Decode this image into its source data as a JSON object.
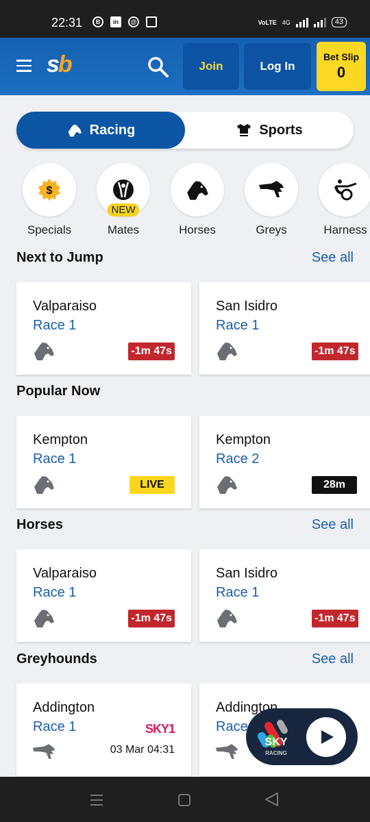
{
  "status_bar": {
    "time": "22:31",
    "notification_icons": [
      "b-icon",
      "linkedin-icon",
      "threads-icon",
      "browser-icon"
    ],
    "network": "4G",
    "battery": "43"
  },
  "header": {
    "logo_s": "s",
    "logo_b": "b",
    "join_label": "Join",
    "login_label": "Log In",
    "betslip_label": "Bet Slip",
    "betslip_count": "0"
  },
  "toggle": {
    "racing_label": "Racing",
    "sports_label": "Sports",
    "active": "Racing"
  },
  "categories": [
    {
      "label": "Specials",
      "icon": "dollar-badge-icon"
    },
    {
      "label": "Mates",
      "icon": "mates-icon",
      "badge": "NEW"
    },
    {
      "label": "Horses",
      "icon": "horse-head-icon"
    },
    {
      "label": "Greys",
      "icon": "greyhound-icon"
    },
    {
      "label": "Harness",
      "icon": "harness-icon"
    }
  ],
  "sections": [
    {
      "title": "Next to Jump",
      "see_all": "See all",
      "cards": [
        {
          "venue": "Valparaiso",
          "race": "Race 1",
          "icon": "horse-head-icon",
          "badge": "-1m 47s",
          "badge_type": "red"
        },
        {
          "venue": "San Isidro",
          "race": "Race 1",
          "icon": "horse-head-icon",
          "badge": "-1m 47s",
          "badge_type": "red"
        }
      ]
    },
    {
      "title": "Popular Now",
      "see_all": "",
      "cards": [
        {
          "venue": "Kempton",
          "race": "Race 1",
          "icon": "horse-head-icon",
          "badge": "LIVE",
          "badge_type": "live"
        },
        {
          "venue": "Kempton",
          "race": "Race 2",
          "icon": "horse-head-icon",
          "badge": "28m",
          "badge_type": "dark"
        }
      ]
    },
    {
      "title": "Horses",
      "see_all": "See all",
      "cards": [
        {
          "venue": "Valparaiso",
          "race": "Race 1",
          "icon": "horse-head-icon",
          "badge": "-1m 47s",
          "badge_type": "red"
        },
        {
          "venue": "San Isidro",
          "race": "Race 1",
          "icon": "horse-head-icon",
          "badge": "-1m 47s",
          "badge_type": "red"
        }
      ]
    },
    {
      "title": "Greyhounds",
      "see_all": "See all",
      "cards": [
        {
          "venue": "Addington",
          "race": "Race 1",
          "icon": "greyhound-icon",
          "channel": "SKY1",
          "datetime": "03 Mar 04:31"
        },
        {
          "venue": "Addington",
          "race": "Race 2",
          "icon": "greyhound-icon"
        }
      ]
    }
  ],
  "sky_player": {
    "logo_text": "SKY",
    "logo_subtext": "RACING"
  },
  "colors": {
    "brand_blue": "#0b55a4",
    "header_blue": "#1c6fc2",
    "yellow": "#fcd824",
    "link_blue": "#1a5ea8",
    "alert_red": "#c1272d"
  }
}
